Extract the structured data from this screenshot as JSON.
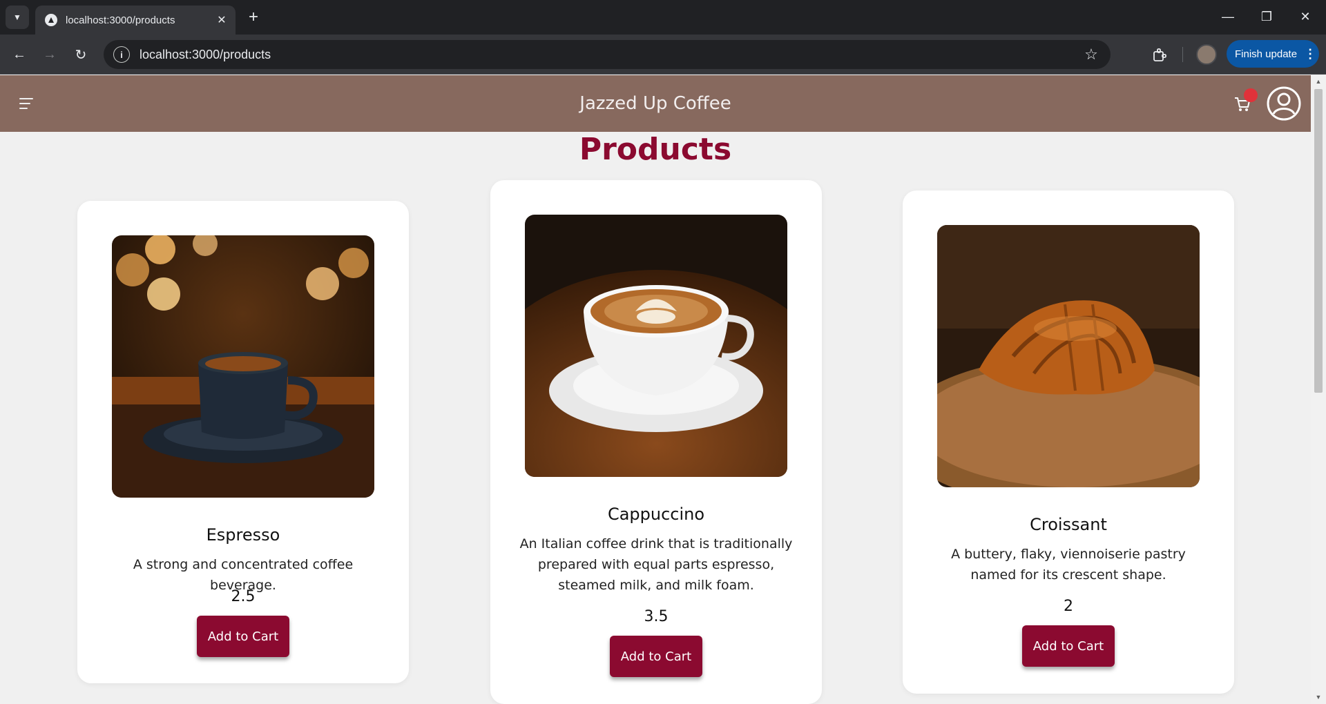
{
  "browser": {
    "tab_title": "localhost:3000/products",
    "url": "localhost:3000/products",
    "finish_update_label": "Finish update"
  },
  "app": {
    "title": "Jazzed Up Coffee",
    "colors": {
      "header": "#87695e",
      "accent": "#8b0a30",
      "badge": "#e0323a"
    }
  },
  "page": {
    "title": "Products"
  },
  "products": [
    {
      "name": "Espresso",
      "description": "A strong and concentrated coffee beverage.",
      "price": "2.5",
      "button_label": "Add to Cart"
    },
    {
      "name": "Cappuccino",
      "description": "An Italian coffee drink that is traditionally prepared with equal parts espresso, steamed milk, and milk foam.",
      "price": "3.5",
      "button_label": "Add to Cart"
    },
    {
      "name": "Croissant",
      "description": "A buttery, flaky, viennoiserie pastry named for its crescent shape.",
      "price": "2",
      "button_label": "Add to Cart"
    }
  ]
}
